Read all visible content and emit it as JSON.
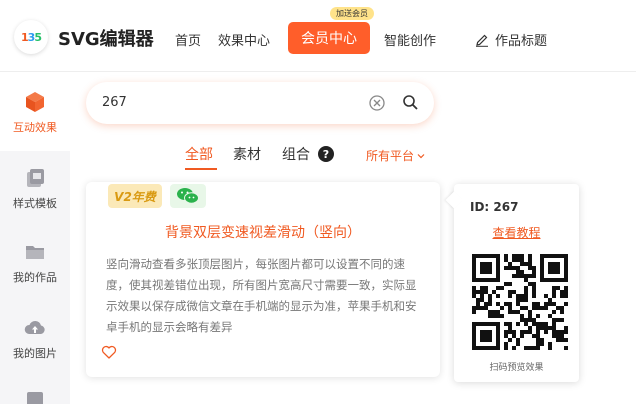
{
  "header": {
    "logo_text": "135",
    "brand": "SVG编辑器",
    "nav": [
      "首页",
      "效果中心"
    ],
    "vip_button": "会员中心",
    "vip_badge": "加送会员",
    "nav_after": "智能创作",
    "title_item": "作品标题",
    "accent": "#ff5e2a"
  },
  "sidebar": {
    "items": [
      {
        "label": "互动效果",
        "icon": "cube-icon",
        "active": true
      },
      {
        "label": "样式模板",
        "icon": "template-icon",
        "active": false
      },
      {
        "label": "我的作品",
        "icon": "folder-icon",
        "active": false
      },
      {
        "label": "我的图片",
        "icon": "cloud-upload-icon",
        "active": false
      }
    ]
  },
  "search": {
    "value": "267"
  },
  "tabs": {
    "items": [
      "全部",
      "素材",
      "组合"
    ],
    "help": "?",
    "platform": "所有平台"
  },
  "card": {
    "badge_v2": "V2年费",
    "title": "背景双层变速视差滑动（竖向）",
    "description": "竖向滑动查看多张顶层图片，每张图片都可以设置不同的速度，使其视差错位出现，所有图片宽高尺寸需要一致，实际显示效果以保存成微信文章在手机端的显示为准，苹果手机和安卓手机的显示会略有差异"
  },
  "popover": {
    "id_text": "ID: 267",
    "link": "查看教程",
    "caption": "扫码预览效果"
  }
}
